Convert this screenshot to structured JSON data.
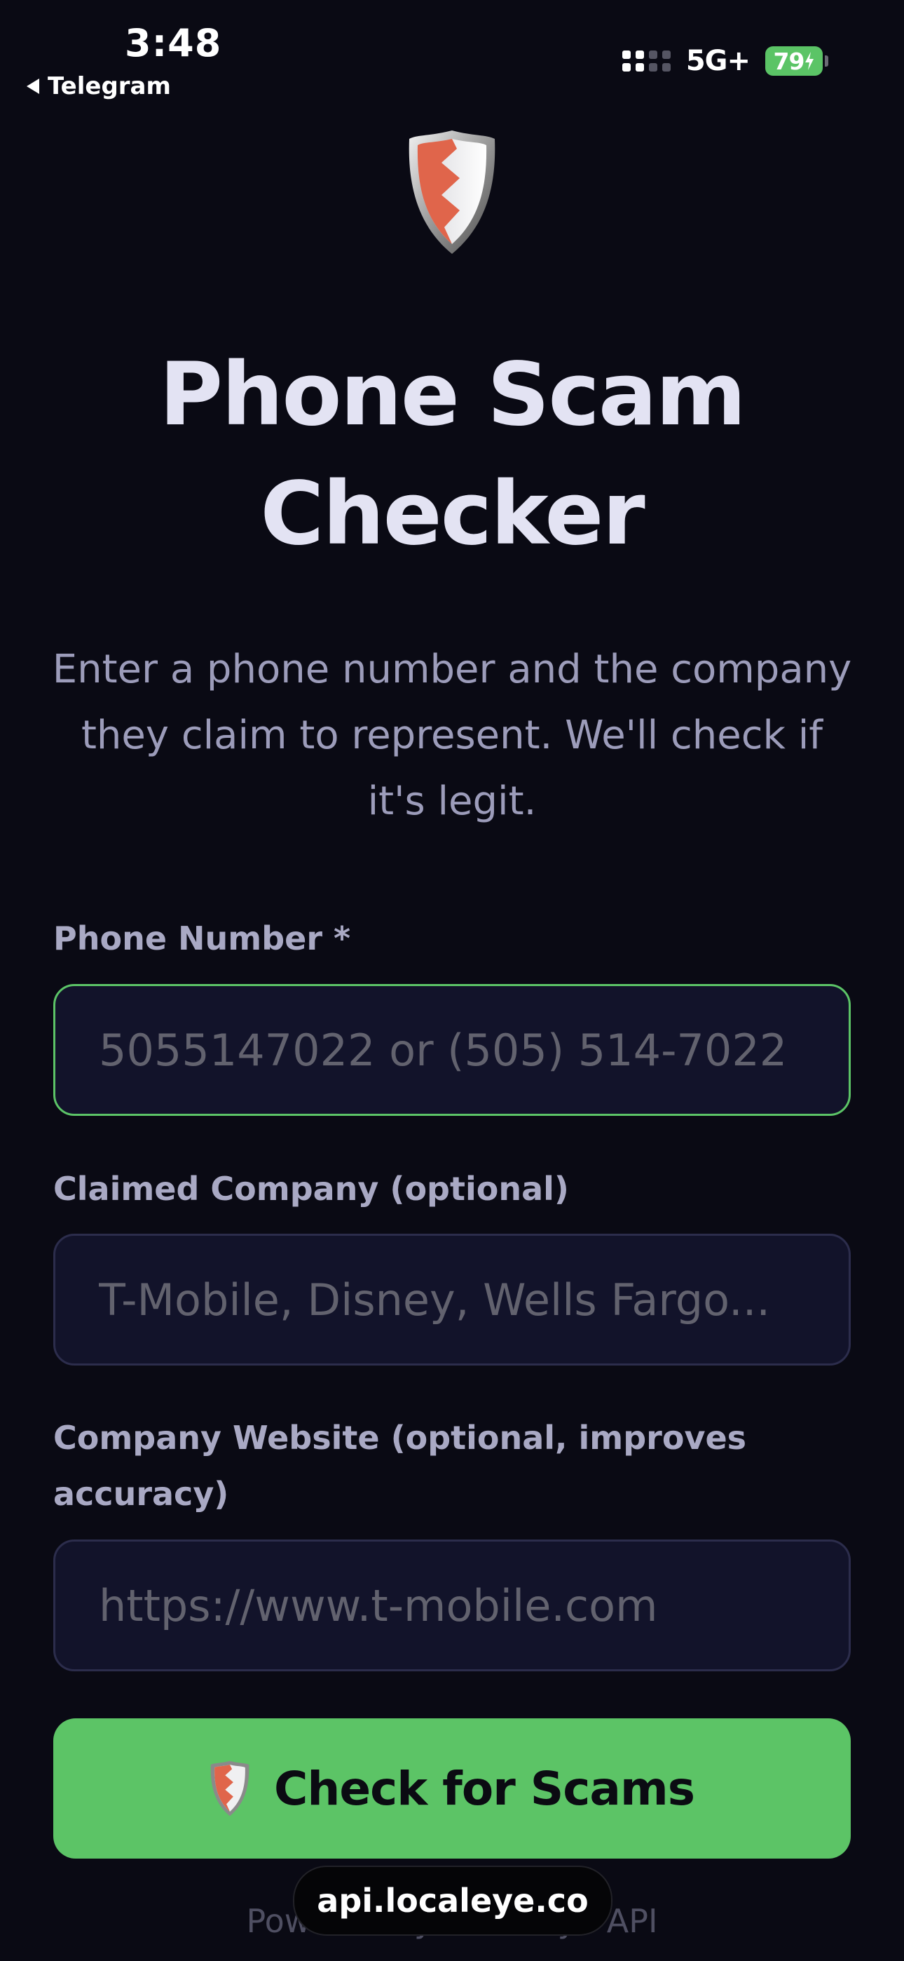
{
  "status_bar": {
    "time": "3:48",
    "back_app": "Telegram",
    "network": "5G+",
    "battery_percent": "79"
  },
  "page": {
    "title_line1": "Phone Scam",
    "title_line2": "Checker",
    "subtitle": "Enter a phone number and the company they claim to represent. We'll check if it's legit."
  },
  "form": {
    "phone": {
      "label": "Phone Number *",
      "value": "",
      "placeholder": "5055147022 or (505) 514-7022"
    },
    "company": {
      "label": "Claimed Company (optional)",
      "value": "",
      "placeholder": "T-Mobile, Disney, Wells Fargo..."
    },
    "website": {
      "label": "Company Website (optional, improves accuracy)",
      "value": "",
      "placeholder": "https://www.t-mobile.com"
    },
    "submit_label": "Check for Scams"
  },
  "footer": {
    "text": "Powered by Local Eye API"
  },
  "browser": {
    "url": "api.localeye.co"
  },
  "icons": {
    "logo": "shield-icon",
    "submit": "shield-icon"
  },
  "colors": {
    "background": "#0a0a14",
    "accent": "#5cc466",
    "field_background": "#12132a",
    "shield_red": "#e0654b"
  }
}
